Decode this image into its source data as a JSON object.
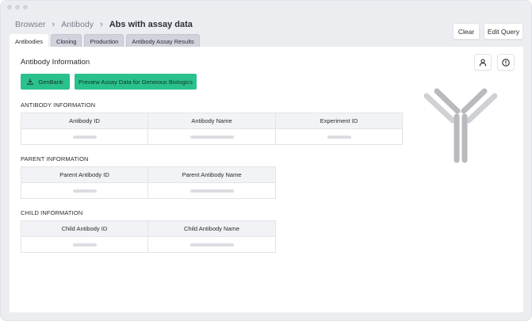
{
  "breadcrumb": {
    "items": [
      "Browser",
      "Antibody"
    ],
    "current": "Abs with assay data"
  },
  "toolbar": {
    "clear_label": "Clear",
    "edit_query_label": "Edit Query"
  },
  "tabs": [
    {
      "label": "Antibodies",
      "active": true
    },
    {
      "label": "Cloning",
      "active": false
    },
    {
      "label": "Production",
      "active": false
    },
    {
      "label": "Antibody Assay Results",
      "active": false
    }
  ],
  "panel": {
    "title": "Antibody Information",
    "genbank_label": "GenBank",
    "preview_label": "Preview Assay Data for Geneious Biologics",
    "icons": {
      "user": "user-icon",
      "help": "help-circle-icon",
      "download": "download-icon",
      "illustration": "antibody-icon"
    },
    "accent_color": "#2ac28c"
  },
  "sections": {
    "antibody": {
      "label": "ANTIBODY INFORMATION",
      "columns": [
        "Antibody ID",
        "Antibody Name",
        "Experiment ID"
      ]
    },
    "parent": {
      "label": "PARENT INFORMATION",
      "columns": [
        "Parent Antibody ID",
        "Parent Antibody Name"
      ]
    },
    "child": {
      "label": "CHILD INFORMATION",
      "columns": [
        "Child Antibody ID",
        "Child Antibody Name"
      ]
    }
  }
}
